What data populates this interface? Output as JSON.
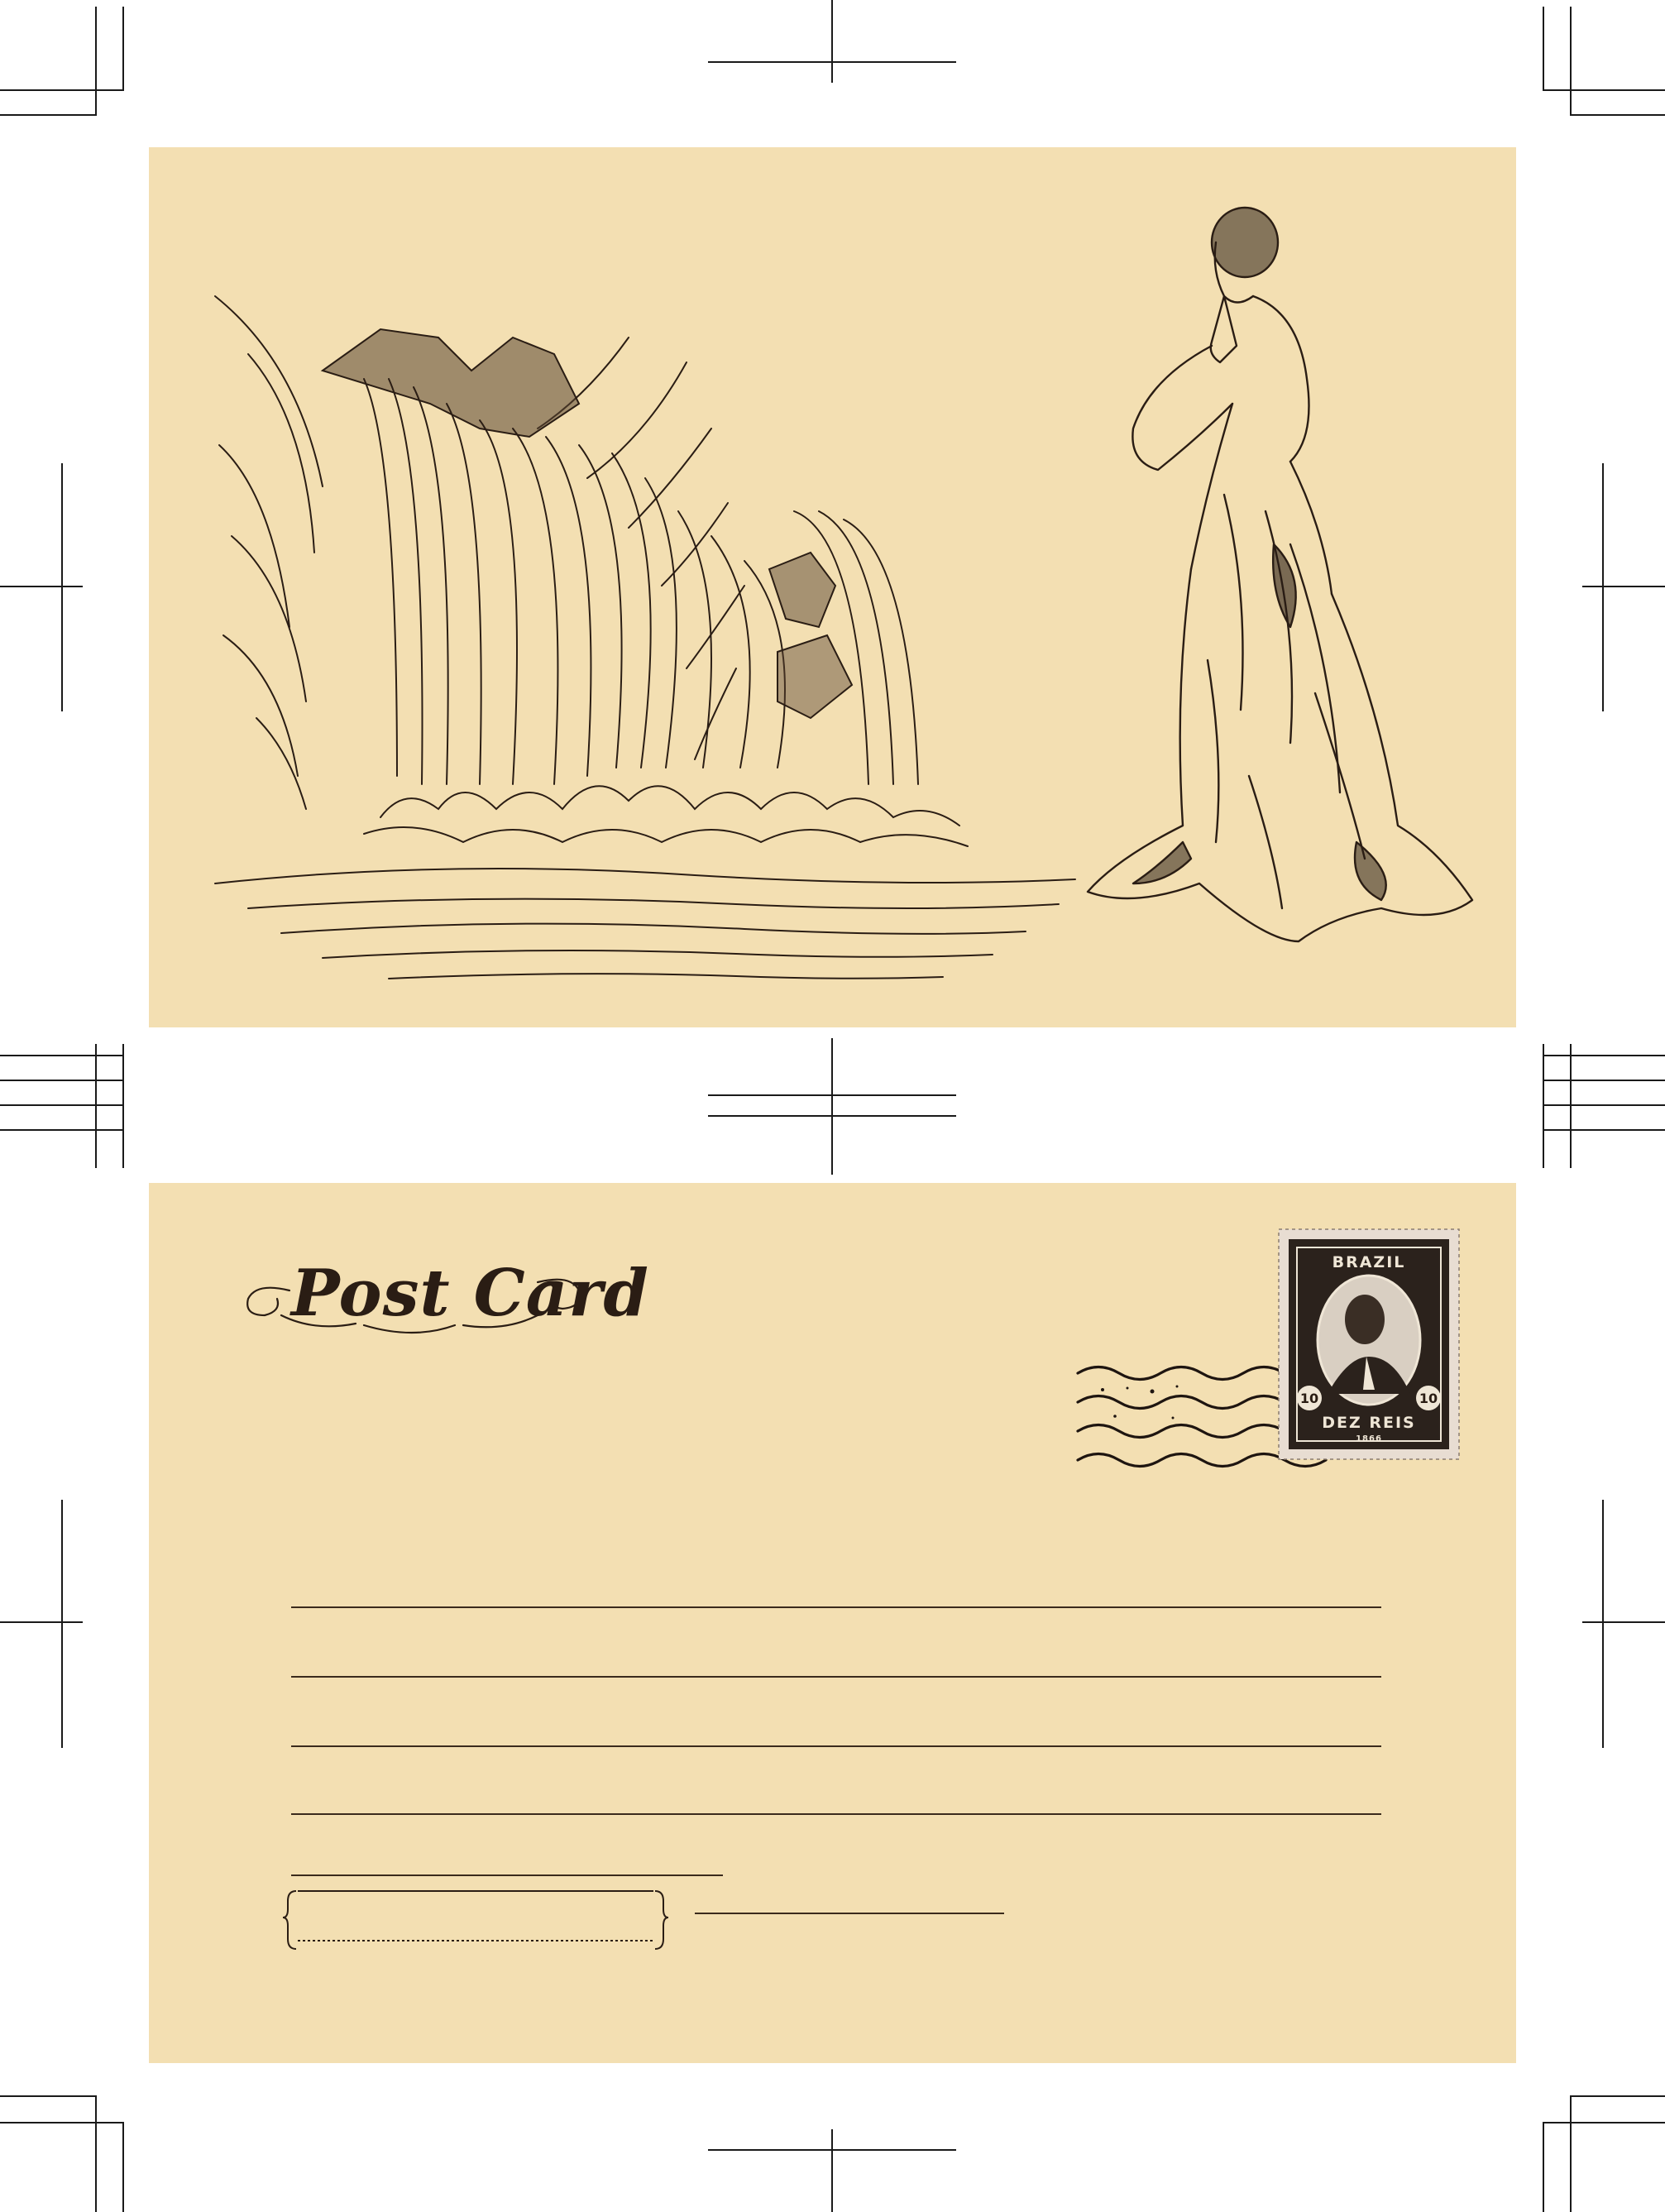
{
  "postcard_front": {
    "illustrations": [
      "waterfall-illustration",
      "praying-woman-illustration"
    ]
  },
  "postcard_back": {
    "logo_text": "Post Card",
    "address_line_count": 5,
    "stamp": {
      "country": "BRAZIL",
      "denomination_left": "10",
      "denomination_right": "10",
      "value_text": "DEZ REIS",
      "year": "1866"
    },
    "postmark_icon": "wavy-cancellation-mark"
  },
  "colors": {
    "card": "#f3dfb2",
    "ink": "#2a1d14",
    "stamp_dark": "#2b221c"
  }
}
